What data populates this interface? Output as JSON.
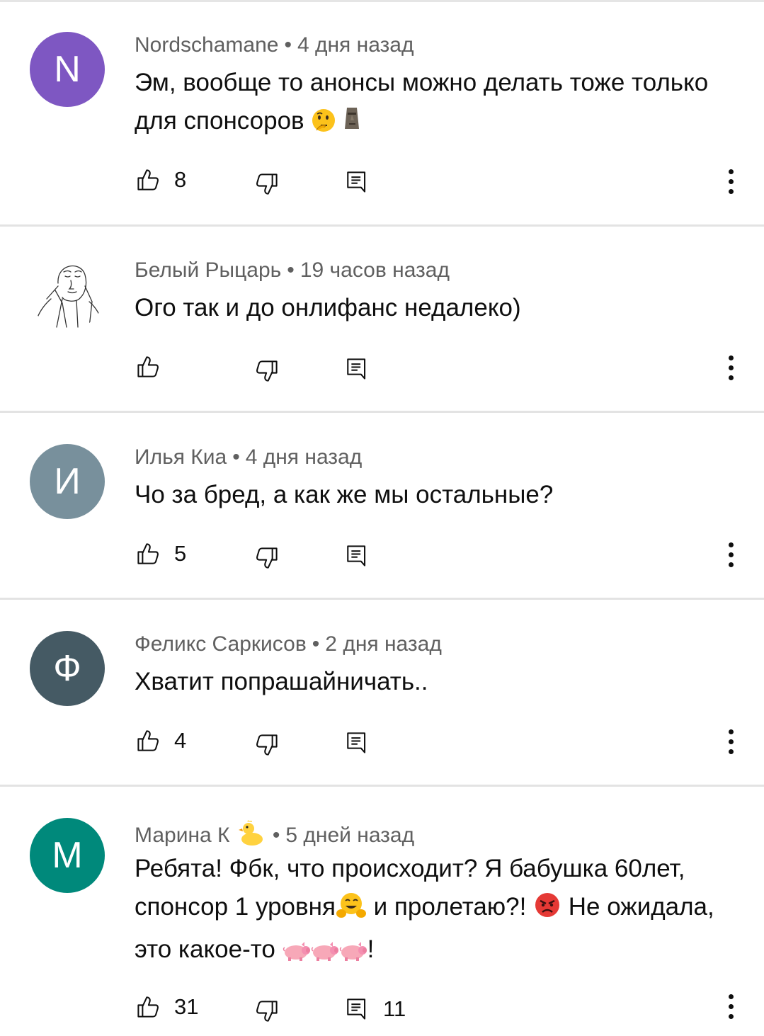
{
  "colors": {
    "avatar_n": "#7e57c2",
    "avatar_i": "#78909c",
    "avatar_f": "#455a64",
    "avatar_m": "#00897b",
    "meta_text": "#606060",
    "divider": "#e3e3e3"
  },
  "comments": [
    {
      "avatar_letter": "N",
      "author": "Nordschamane",
      "time": "4 дня назад",
      "text_parts": [
        "Эм, вообще то анонсы можно делать тоже только для спонсоров"
      ],
      "emojis": [
        "thinking-face-emoji",
        "moai-emoji"
      ],
      "likes": "8",
      "replies": ""
    },
    {
      "avatar_letter": "",
      "avatar_image": "sketch-man-face-avatar",
      "author": "Белый Рыцарь",
      "time": "19 часов назад",
      "text_parts": [
        "Ого так и до онлифанс недалеко)"
      ],
      "likes": "",
      "replies": ""
    },
    {
      "avatar_letter": "И",
      "author": "Илья Киа",
      "time": "4 дня назад",
      "text_parts": [
        "Чо за бред, а как же мы остальные?"
      ],
      "likes": "5",
      "replies": ""
    },
    {
      "avatar_letter": "Ф",
      "author": "Феликс Саркисов",
      "time": "2 дня назад",
      "text_parts": [
        "Хватит попрашайничать.."
      ],
      "likes": "4",
      "replies": ""
    },
    {
      "avatar_letter": "M",
      "author": "Марина К",
      "author_badge": "duck-emoji",
      "time": "5 дней назад",
      "text_parts": [
        "Ребята! Фбк, что происходит? Я бабушка 60лет, спонсор 1 уровня",
        " и пролетаю?! ",
        " Не ожидала, это какое-то ",
        "!"
      ],
      "emojis": [
        "hugging-face-emoji",
        "angry-face-emoji",
        "pig-emoji",
        "pig-emoji",
        "pig-emoji"
      ],
      "likes": "31",
      "replies": "11"
    }
  ]
}
